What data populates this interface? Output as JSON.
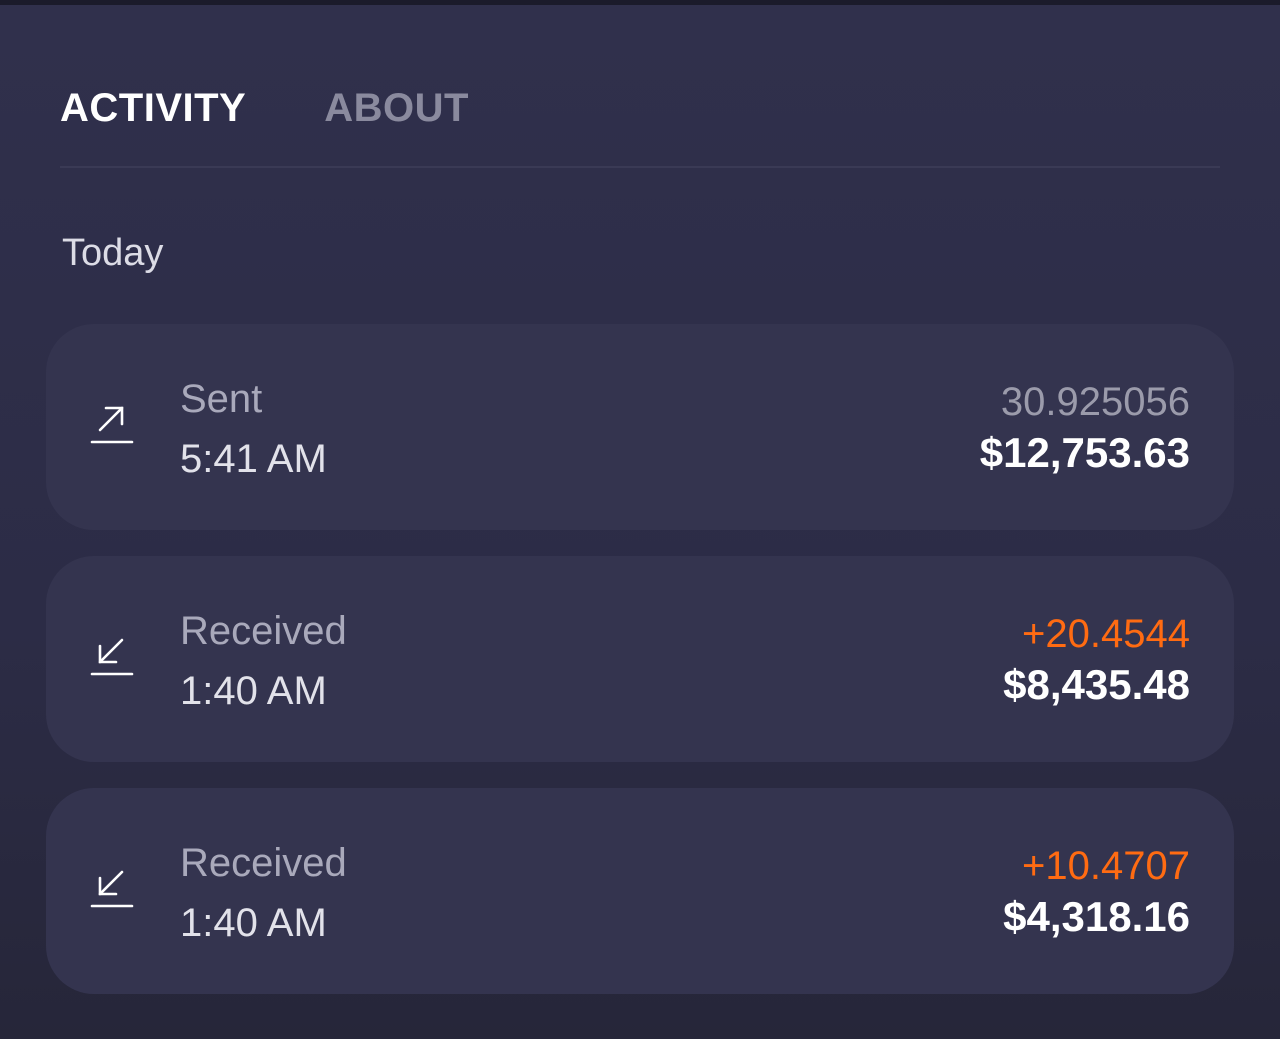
{
  "tabs": [
    {
      "label": "ACTIVITY",
      "active": true
    },
    {
      "label": "ABOUT",
      "active": false
    }
  ],
  "section": {
    "title": "Today"
  },
  "transactions": [
    {
      "type": "Sent",
      "time": "5:41 AM",
      "amount": "30.925056",
      "fiat": "$12,753.63",
      "icon": "arrow-up-right-icon"
    },
    {
      "type": "Received",
      "time": "1:40 AM",
      "amount": "+20.4544",
      "fiat": "$8,435.48",
      "icon": "arrow-down-left-icon"
    },
    {
      "type": "Received",
      "time": "1:40 AM",
      "amount": "+10.4707",
      "fiat": "$4,318.16",
      "icon": "arrow-down-left-icon"
    }
  ],
  "colors": {
    "background": "#2e2e48",
    "card": "#34344f",
    "accent_positive": "#ff6b12",
    "muted_text": "#9b9bab"
  }
}
